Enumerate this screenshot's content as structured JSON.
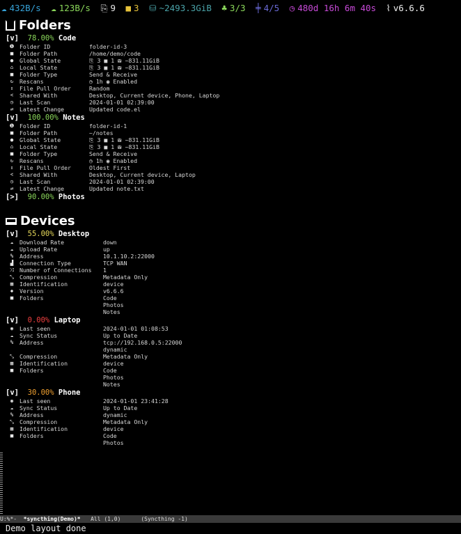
{
  "header": {
    "down_rate": "432B/s",
    "up_rate": "123B/s",
    "files_count": "9",
    "folders_count": "3",
    "size": "~2493.3GiB",
    "connected": "3/3",
    "shared": "4/5",
    "uptime": "480d 16h 6m 40s",
    "version": "v6.6.6",
    "icons": {
      "down": "cloud-download-icon",
      "up": "cloud-upload-icon",
      "files": "files-icon",
      "folders": "folder-icon",
      "size": "hdd-icon",
      "connected": "sitemap-icon",
      "shared": "signpost-icon",
      "uptime": "clock-icon",
      "version": "tag-icon"
    },
    "colors": {
      "down": "#36a3d9",
      "up": "#8bd85b",
      "files": "#e8e8e8",
      "folders": "#e6c23a",
      "size": "#4aa3a8",
      "connected": "#8bd85b",
      "shared": "#6b6bd8",
      "uptime": "#c84ad8",
      "version": "#f0f0f0"
    }
  },
  "folders_section": {
    "title": "Folders",
    "icon": "folder-square-icon",
    "folders": [
      {
        "toggle": "[v]",
        "percent": "78.00%",
        "name": "Code",
        "rows": [
          {
            "icon": "info-icon",
            "label": "Folder ID",
            "value": "folder-id-3"
          },
          {
            "icon": "folder-icon",
            "label": "Folder Path",
            "value": "/home/demo/code"
          },
          {
            "icon": "globe-icon",
            "label": "Global State",
            "value": "⎘ 3 ■ 1 ⛁ ~831.11GiB"
          },
          {
            "icon": "home-icon",
            "label": "Local State",
            "value": "⎘ 3 ■ 1 ⛁ ~831.11GiB"
          },
          {
            "icon": "folder-icon",
            "label": "Folder Type",
            "value": "Send & Receive"
          },
          {
            "icon": "refresh-icon",
            "label": "Rescans",
            "value": "◷ 1h ◉ Enabled"
          },
          {
            "icon": "sort-icon",
            "label": "File Pull Order",
            "value": "Random"
          },
          {
            "icon": "share-icon",
            "label": "Shared With",
            "value": "Desktop, Current device, Phone, Laptop"
          },
          {
            "icon": "clock-icon",
            "label": "Last Scan",
            "value": "2024-01-01 02:39:00"
          },
          {
            "icon": "exchange-icon",
            "label": "Latest Change",
            "value": "Updated code.el"
          }
        ]
      },
      {
        "toggle": "[v]",
        "percent": "100.00%",
        "name": "Notes",
        "rows": [
          {
            "icon": "info-icon",
            "label": "Folder ID",
            "value": "folder-id-1"
          },
          {
            "icon": "folder-icon",
            "label": "Folder Path",
            "value": "~/notes"
          },
          {
            "icon": "globe-icon",
            "label": "Global State",
            "value": "⎘ 3 ■ 1 ⛁ ~831.11GiB"
          },
          {
            "icon": "home-icon",
            "label": "Local State",
            "value": "⎘ 3 ■ 1 ⛁ ~831.11GiB"
          },
          {
            "icon": "folder-icon",
            "label": "Folder Type",
            "value": "Send & Receive"
          },
          {
            "icon": "refresh-icon",
            "label": "Rescans",
            "value": "◷ 1h ◉ Enabled"
          },
          {
            "icon": "sort-icon",
            "label": "File Pull Order",
            "value": "Oldest First"
          },
          {
            "icon": "share-icon",
            "label": "Shared With",
            "value": "Desktop, Current device, Laptop"
          },
          {
            "icon": "clock-icon",
            "label": "Last Scan",
            "value": "2024-01-01 02:39:00"
          },
          {
            "icon": "exchange-icon",
            "label": "Latest Change",
            "value": "Updated note.txt"
          }
        ]
      },
      {
        "toggle": "[>]",
        "percent": "90.00%",
        "name": "Photos",
        "rows": []
      }
    ]
  },
  "devices_section": {
    "title": "Devices",
    "icon": "laptop-icon",
    "devices": [
      {
        "toggle": "[v]",
        "percent": "55.00%",
        "name": "Desktop",
        "rows": [
          {
            "icon": "cloud-download-icon",
            "label": "Download Rate",
            "value": "down"
          },
          {
            "icon": "cloud-upload-icon",
            "label": "Upload Rate",
            "value": "up"
          },
          {
            "icon": "link-icon",
            "label": "Address",
            "value": "10.1.10.2:22000"
          },
          {
            "icon": "signal-icon",
            "label": "Connection Type",
            "value": "TCP WAN"
          },
          {
            "icon": "random-icon",
            "label": "Number of Connections",
            "value": "1"
          },
          {
            "icon": "compress-icon",
            "label": "Compression",
            "value": "Metadata Only"
          },
          {
            "icon": "qrcode-icon",
            "label": "Identification",
            "value": "device"
          },
          {
            "icon": "tag-icon",
            "label": "Version",
            "value": "v6.6.6"
          },
          {
            "icon": "folder-icon",
            "label": "Folders",
            "value": "Code"
          },
          {
            "icon": "",
            "label": "",
            "value": "Photos"
          },
          {
            "icon": "",
            "label": "",
            "value": "Notes"
          }
        ]
      },
      {
        "toggle": "[v]",
        "percent": "0.00%",
        "name": "Laptop",
        "rows": [
          {
            "icon": "eye-icon",
            "label": "Last seen",
            "value": "2024-01-01 01:08:53"
          },
          {
            "icon": "cloud-icon",
            "label": "Sync Status",
            "value": "Up to Date"
          },
          {
            "icon": "link-icon",
            "label": "Address",
            "value": "tcp://192.168.0.5:22000"
          },
          {
            "icon": "",
            "label": "",
            "value": "dynamic"
          },
          {
            "icon": "compress-icon",
            "label": "Compression",
            "value": "Metadata Only"
          },
          {
            "icon": "qrcode-icon",
            "label": "Identification",
            "value": "device"
          },
          {
            "icon": "folder-icon",
            "label": "Folders",
            "value": "Code"
          },
          {
            "icon": "",
            "label": "",
            "value": "Photos"
          },
          {
            "icon": "",
            "label": "",
            "value": "Notes"
          }
        ]
      },
      {
        "toggle": "[v]",
        "percent": "30.00%",
        "name": "Phone",
        "rows": [
          {
            "icon": "eye-icon",
            "label": "Last seen",
            "value": "2024-01-01 23:41:28"
          },
          {
            "icon": "cloud-icon",
            "label": "Sync Status",
            "value": "Up to Date"
          },
          {
            "icon": "link-icon",
            "label": "Address",
            "value": "dynamic"
          },
          {
            "icon": "compress-icon",
            "label": "Compression",
            "value": "Metadata Only"
          },
          {
            "icon": "qrcode-icon",
            "label": "Identification",
            "value": "device"
          },
          {
            "icon": "folder-icon",
            "label": "Folders",
            "value": "Code"
          },
          {
            "icon": "",
            "label": "",
            "value": "Photos"
          }
        ]
      }
    ]
  },
  "modeline": {
    "status": "U:%*-",
    "buffer": "*syncthing(Demo)*",
    "position": "All (1,0)",
    "mode": "(Syncthing -1)"
  },
  "echo": "Demo layout done"
}
